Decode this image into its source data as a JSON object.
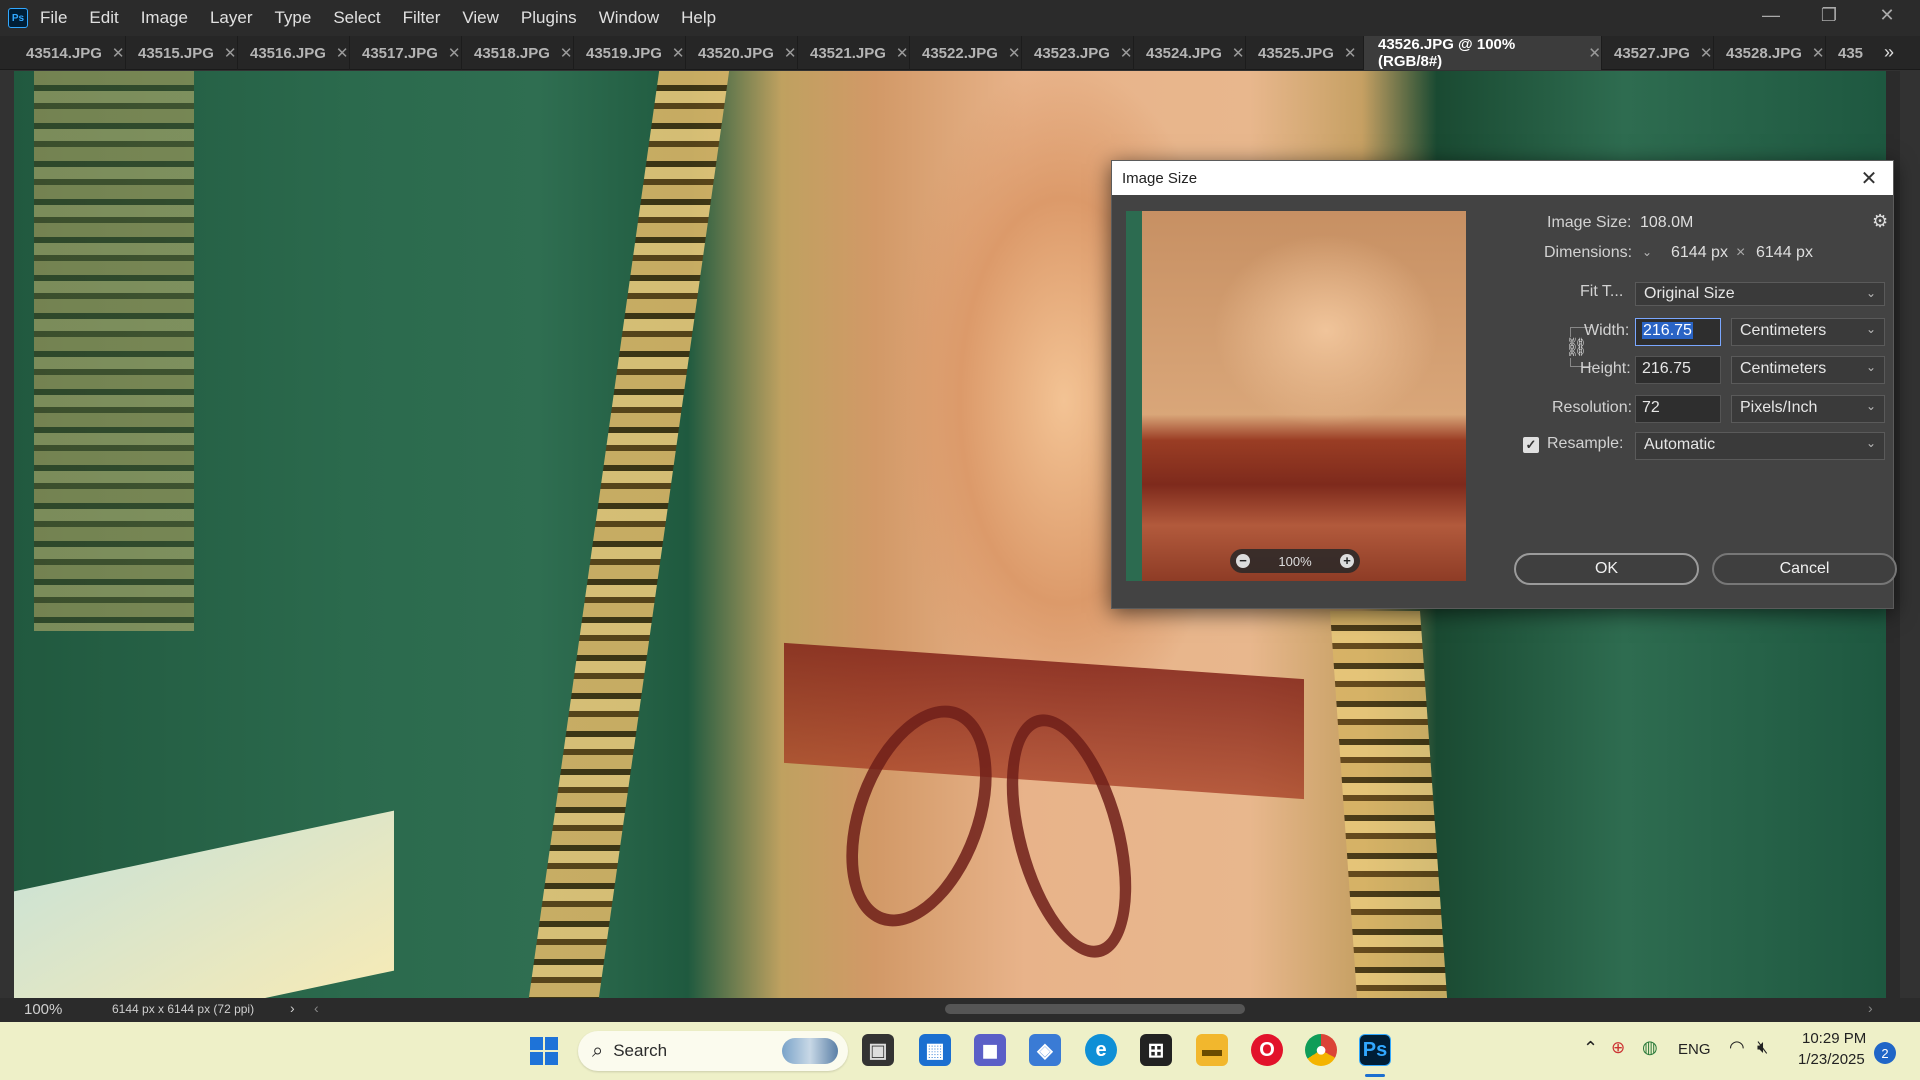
{
  "app": {
    "logo": "Ps"
  },
  "menu": [
    "File",
    "Edit",
    "Image",
    "Layer",
    "Type",
    "Select",
    "Filter",
    "View",
    "Plugins",
    "Window",
    "Help"
  ],
  "tabs": [
    {
      "label": "43514.JPG"
    },
    {
      "label": "43515.JPG"
    },
    {
      "label": "43516.JPG"
    },
    {
      "label": "43517.JPG"
    },
    {
      "label": "43518.JPG"
    },
    {
      "label": "43519.JPG"
    },
    {
      "label": "43520.JPG"
    },
    {
      "label": "43521.JPG"
    },
    {
      "label": "43522.JPG"
    },
    {
      "label": "43523.JPG"
    },
    {
      "label": "43524.JPG"
    },
    {
      "label": "43525.JPG"
    },
    {
      "label": "43526.JPG @ 100% (RGB/8#)",
      "active": true
    },
    {
      "label": "43527.JPG"
    },
    {
      "label": "43528.JPG"
    },
    {
      "label": "435"
    }
  ],
  "tab_overflow_icon": "double-chevron-right-icon",
  "status": {
    "zoom": "100%",
    "doc_info": "6144 px x 6144 px (72 ppi)"
  },
  "dialog": {
    "title": "Image Size",
    "image_size_label": "Image Size:",
    "image_size_value": "108.0M",
    "dimensions_label": "Dimensions:",
    "dim_width": "6144 px",
    "dim_sep": "×",
    "dim_height": "6144 px",
    "fit_label": "Fit T...",
    "fit_value": "Original Size",
    "width_label": "Width:",
    "width_value": "216.75",
    "width_unit": "Centimeters",
    "height_label": "Height:",
    "height_value": "216.75",
    "height_unit": "Centimeters",
    "resolution_label": "Resolution:",
    "resolution_value": "72",
    "resolution_unit": "Pixels/Inch",
    "resample_label": "Resample:",
    "resample_value": "Automatic",
    "resample_checked": true,
    "preview_zoom": "100%",
    "ok_label": "OK",
    "cancel_label": "Cancel"
  },
  "taskbar": {
    "search_label": "Search",
    "lang": "ENG",
    "time": "10:29 PM",
    "date": "1/23/2025",
    "notification_count": "2"
  }
}
